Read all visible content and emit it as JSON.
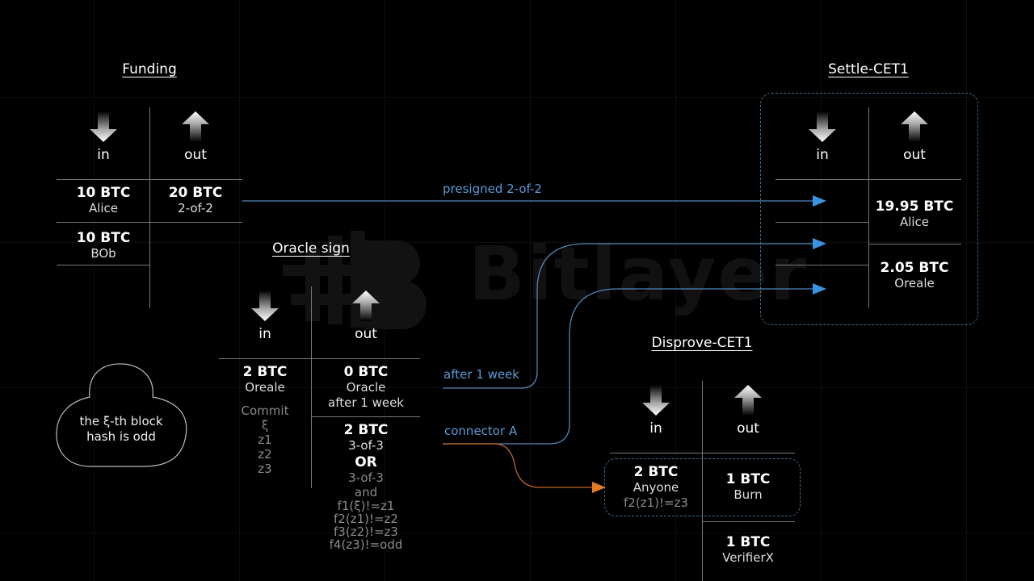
{
  "watermark": {
    "brand": "Bitlayer",
    "logo_icon": "bitlayer-b-logo-icon"
  },
  "colors": {
    "flow_blue": "#5a9bd5",
    "flow_orange": "#e07b2a",
    "dashed_box": "#3d6a91"
  },
  "columns": {
    "in_label": "in",
    "out_label": "out",
    "in_icon": "arrow-down-icon",
    "out_icon": "arrow-up-icon"
  },
  "funding": {
    "title": "Funding",
    "inputs": [
      {
        "amount": "10 BTC",
        "owner": "Alice"
      },
      {
        "amount": "10 BTC",
        "owner": "BOb"
      }
    ],
    "outputs": [
      {
        "amount": "20 BTC",
        "owner": "2-of-2"
      }
    ]
  },
  "oracle_sign": {
    "title": "Oracle sign",
    "inputs": [
      {
        "amount": "2 BTC",
        "owner": "Oreale",
        "notes": [
          "Commit",
          "ξ",
          "z1",
          "z2",
          "z3"
        ]
      }
    ],
    "outputs": [
      {
        "amount": "0 BTC",
        "owner": "Oracle",
        "condition": "after 1 week"
      },
      {
        "amount": "2 BTC",
        "owner": "3-of-3",
        "or_label": "OR",
        "alt_conditions": [
          "3-of-3",
          "and",
          "f1(ξ)!=z1",
          "f2(z1)!=z2",
          "f3(z2)!=z3",
          "f4(z3)!=odd"
        ]
      }
    ]
  },
  "cloud": {
    "lines": [
      "the ξ-th block",
      "hash is odd"
    ]
  },
  "settle_cet1": {
    "title": "Settle-CET1",
    "outputs": [
      {
        "amount": "19.95 BTC",
        "owner": "Alice"
      },
      {
        "amount": "2.05 BTC",
        "owner": "Oreale"
      }
    ]
  },
  "disprove_cet1": {
    "title": "Disprove-CET1",
    "inputs": [
      {
        "amount": "2 BTC",
        "owner": "Anyone",
        "condition": "f2(z1)!=z3"
      }
    ],
    "outputs": [
      {
        "amount": "1 BTC",
        "owner": "Burn"
      },
      {
        "amount": "1 BTC",
        "owner": "VerifierX"
      }
    ]
  },
  "flows": [
    {
      "label": "presigned 2-of-2",
      "from": "Funding 20 BTC 2-of-2",
      "to": "Settle-CET1 input 1",
      "color": "blue"
    },
    {
      "label": "after 1 week",
      "from": "Oracle sign 0 BTC Oracle",
      "to": "Settle-CET1 input 2",
      "color": "blue"
    },
    {
      "label": "connector A",
      "from": "Oracle sign 2 BTC 3-of-3",
      "to": "Settle-CET1 input 3",
      "color": "blue"
    },
    {
      "label": "",
      "from": "Oracle sign 2 BTC 3-of-3",
      "to": "Disprove-CET1 2 BTC Anyone",
      "color": "orange"
    }
  ]
}
